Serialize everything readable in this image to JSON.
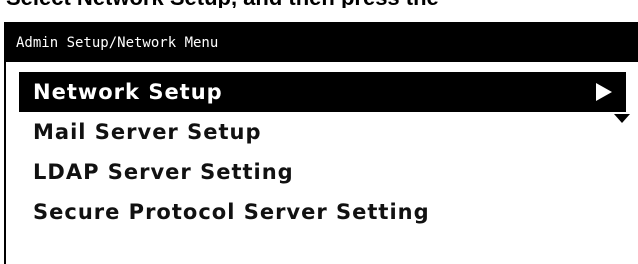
{
  "top_caption": "Select Network Setup, and then press the",
  "window": {
    "title": "Admin Setup/Network Menu"
  },
  "menu": {
    "items": [
      {
        "label": "Network Setup",
        "selected": true
      },
      {
        "label": "Mail Server Setup",
        "selected": false
      },
      {
        "label": "LDAP Server Setting",
        "selected": false
      },
      {
        "label": "Secure Protocol Server Setting",
        "selected": false
      }
    ]
  },
  "icons": {
    "submenu_arrow": "right-arrow-icon",
    "scroll_indicator": "down-arrow-icon"
  },
  "colors": {
    "titlebar_bg": "#000000",
    "selected_bg": "#000000",
    "text": "#111111",
    "background": "#ffffff"
  }
}
